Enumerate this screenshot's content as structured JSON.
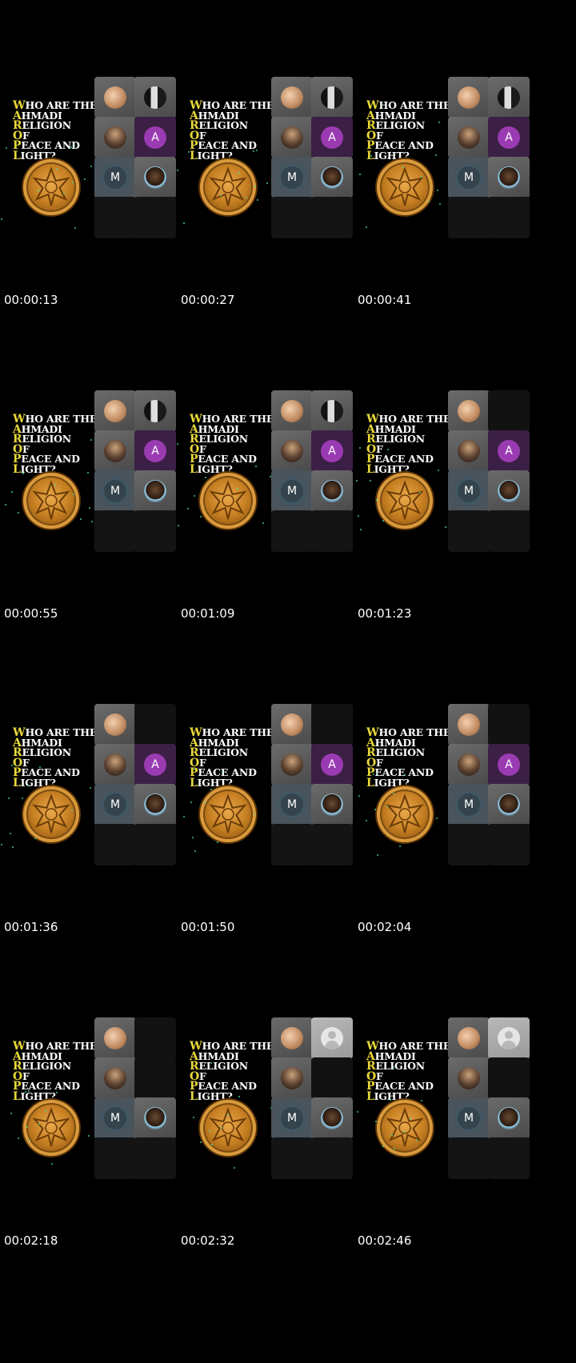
{
  "title_lines": [
    {
      "cap": "W",
      "rest": "HO ARE THE"
    },
    {
      "cap": "A",
      "rest": "HMADI"
    },
    {
      "cap": "R",
      "rest": "ELIGION"
    },
    {
      "cap": "O",
      "rest": "F"
    },
    {
      "cap": "P",
      "rest": "EACE AND"
    },
    {
      "cap": "L",
      "rest": "IGHT?"
    }
  ],
  "frames": [
    {
      "timestamp": "00:00:13",
      "tiles": [
        "peach",
        "suit",
        "people",
        "a",
        "m",
        "face",
        "empty",
        "empty"
      ]
    },
    {
      "timestamp": "00:00:27",
      "tiles": [
        "peach",
        "suit",
        "people",
        "a",
        "m",
        "face",
        "empty",
        "empty"
      ]
    },
    {
      "timestamp": "00:00:41",
      "tiles": [
        "peach",
        "suit",
        "people",
        "a",
        "m",
        "face",
        "empty",
        "empty"
      ]
    },
    {
      "timestamp": "00:00:55",
      "tiles": [
        "peach",
        "suit",
        "people",
        "a",
        "m",
        "face",
        "empty",
        "empty"
      ]
    },
    {
      "timestamp": "00:01:09",
      "tiles": [
        "peach",
        "suit",
        "people",
        "a",
        "m",
        "face",
        "empty",
        "empty"
      ]
    },
    {
      "timestamp": "00:01:23",
      "tiles": [
        "peach",
        "dark",
        "people",
        "a",
        "m",
        "face",
        "empty",
        "empty"
      ]
    },
    {
      "timestamp": "00:01:36",
      "tiles": [
        "peach",
        "dark",
        "people",
        "a",
        "m",
        "face",
        "empty",
        "empty"
      ]
    },
    {
      "timestamp": "00:01:50",
      "tiles": [
        "peach",
        "dark",
        "people",
        "a",
        "m",
        "face",
        "empty",
        "empty"
      ]
    },
    {
      "timestamp": "00:02:04",
      "tiles": [
        "peach",
        "dark",
        "people",
        "a",
        "m",
        "face",
        "empty",
        "empty"
      ]
    },
    {
      "timestamp": "00:02:18",
      "tiles": [
        "peach",
        "dark",
        "people",
        "dark",
        "m",
        "face",
        "empty",
        "empty"
      ]
    },
    {
      "timestamp": "00:02:32",
      "tiles": [
        "peach",
        "person",
        "people",
        "dark",
        "m",
        "face",
        "empty",
        "empty"
      ]
    },
    {
      "timestamp": "00:02:46",
      "tiles": [
        "peach",
        "person",
        "people",
        "dark",
        "m",
        "face",
        "empty",
        "empty"
      ]
    }
  ],
  "avatar_letters": {
    "a": "A",
    "m": "M"
  },
  "colors": {
    "background": "#000000",
    "title_accent": "#e8d83a",
    "medallion": "#c57f22",
    "sparkle": "#49e3a2",
    "avatar_a": "#9b3bb3"
  }
}
